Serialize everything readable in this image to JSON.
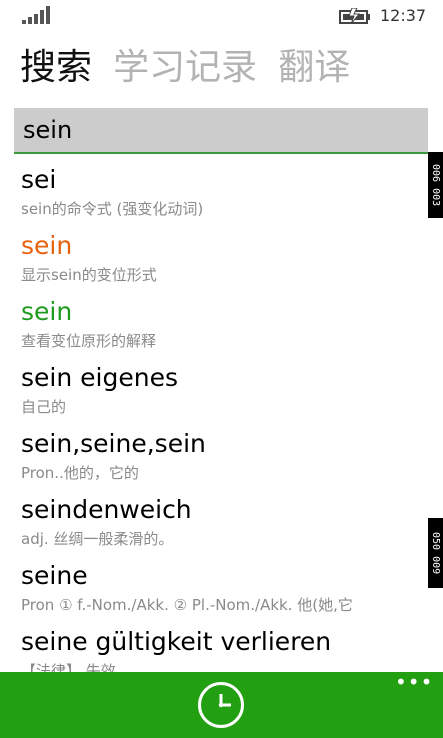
{
  "status_bar": {
    "time": "12:37",
    "signal_icon": "signal-icon",
    "battery_icon": "battery-charging-icon"
  },
  "pivot": {
    "tabs": [
      {
        "label": "搜索",
        "active": true
      },
      {
        "label": "学习记录",
        "active": false
      },
      {
        "label": "翻译",
        "active": false
      }
    ]
  },
  "search": {
    "value": "sein"
  },
  "results": [
    {
      "word": "sei",
      "definition": "sein的命令式 (强变化动词)",
      "color": "#000000"
    },
    {
      "word": "sein",
      "definition": "显示sein的变位形式",
      "color": "#e8620e"
    },
    {
      "word": "sein",
      "definition": "查看变位原形的解释",
      "color": "#1e9a1e"
    },
    {
      "word": "sein eigenes",
      "definition": "自己的",
      "color": "#000000"
    },
    {
      "word": "sein,seine,sein",
      "definition": "Pron..他的，它的",
      "color": "#000000"
    },
    {
      "word": "seindenweich",
      "definition": "adj.  丝绸一般柔滑的。",
      "color": "#000000"
    },
    {
      "word": "seine",
      "definition": "Pron     ① f.-Nom./Akk.     ② Pl.-Nom./Akk. 他(她,它",
      "color": "#000000"
    },
    {
      "word": "seine gültigkeit verlieren",
      "definition": "【法律】 失效",
      "color": "#000000"
    }
  ],
  "side_markers": {
    "top": "006  003",
    "bottom": "050  009"
  },
  "app_bar": {
    "background": "#22a012",
    "history_icon": "clock-icon",
    "more_label": "•••"
  }
}
